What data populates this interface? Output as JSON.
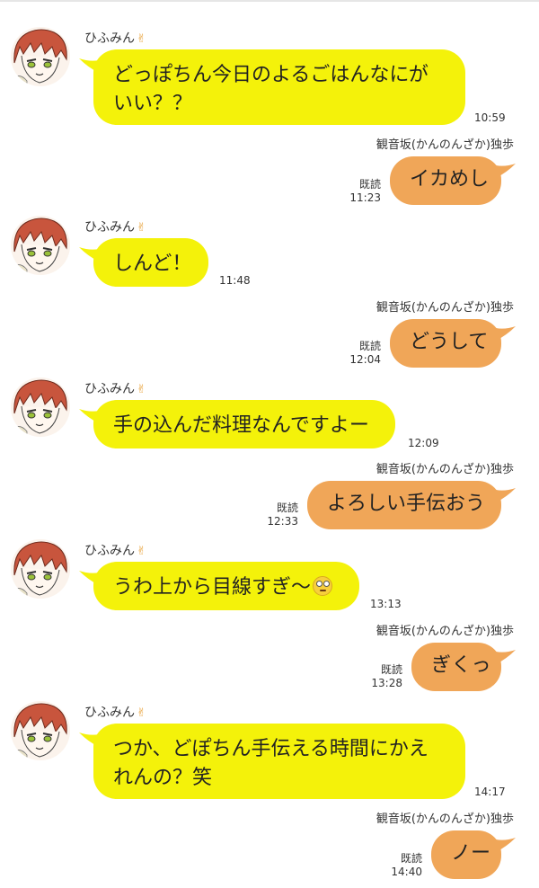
{
  "friend_name": "ひふみん",
  "my_name": "観音坂(かんのんざか)独歩",
  "read_label": "既読",
  "colors": {
    "incoming_bubble": "#f4f20a",
    "outgoing_bubble": "#f0a658",
    "background": "#ffffff"
  },
  "messages": [
    {
      "from": "friend",
      "text_lines": [
        "どっぽちん今日のよるごはんなにが",
        "いい？？"
      ],
      "time": "10:59"
    },
    {
      "from": "me",
      "text": "イカめし",
      "time": "11:23",
      "read": true
    },
    {
      "from": "friend",
      "text_lines": [
        "しんど！"
      ],
      "time": "11:48"
    },
    {
      "from": "me",
      "text": "どうして",
      "time": "12:04",
      "read": true
    },
    {
      "from": "friend",
      "text_lines": [
        "手の込んだ料理なんですよー"
      ],
      "time": "12:09"
    },
    {
      "from": "me",
      "text": "よろしい手伝おう",
      "time": "12:33",
      "read": true
    },
    {
      "from": "friend",
      "text_lines": [
        "うわ上から目線すぎ〜"
      ],
      "emoji": "face-with-rolling-eyes-icon",
      "time": "13:13"
    },
    {
      "from": "me",
      "text": "ぎくっ",
      "time": "13:28",
      "read": true
    },
    {
      "from": "friend",
      "text_lines": [
        "つか、どぽちん手伝える時間にかえ",
        "れんの？笑"
      ],
      "time": "14:17"
    },
    {
      "from": "me",
      "text": "ノー",
      "time": "14:40",
      "read": true
    }
  ]
}
